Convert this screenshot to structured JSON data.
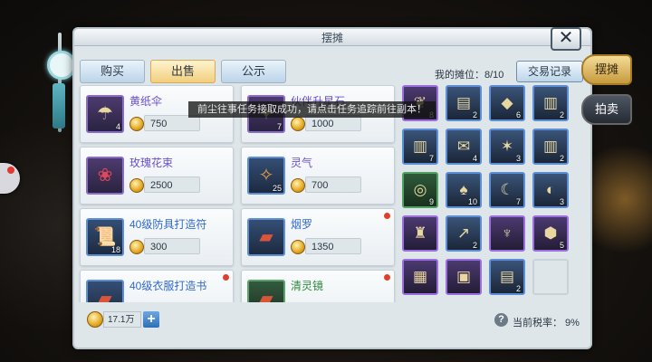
{
  "window": {
    "title": "摆摊",
    "close_glyph": "✕"
  },
  "tabs": {
    "buy": "购买",
    "sell": "出售",
    "public": "公示"
  },
  "stall_info": "我的摊位：8/10",
  "trade_log": "交易记录",
  "side_tabs": {
    "stall": "摆摊",
    "auction": "拍卖"
  },
  "listings": [
    {
      "name": "黄纸伞",
      "count": "4",
      "price": "750",
      "icon": "umbrella-icon",
      "rarity": "purple"
    },
    {
      "name": "伙伴升星石",
      "count": "7",
      "price": "1000",
      "icon": "star-stone-icon",
      "rarity": "purple"
    },
    {
      "name": "玫瑰花束",
      "count": "",
      "price": "2500",
      "icon": "rose-bouquet-icon",
      "rarity": "purple"
    },
    {
      "name": "灵气",
      "count": "25",
      "price": "700",
      "icon": "aura-icon",
      "rarity": "blue"
    },
    {
      "name": "40级防具打造符",
      "count": "18",
      "price": "300",
      "icon": "scroll-icon",
      "rarity": "blue"
    },
    {
      "name": "烟罗",
      "count": "",
      "price": "1350",
      "icon": "firework-icon",
      "rarity": "blue"
    },
    {
      "name": "40级衣服打造书",
      "count": "",
      "price": "",
      "icon": "book-icon",
      "rarity": "blue"
    },
    {
      "name": "清灵镜",
      "count": "",
      "price": "",
      "icon": "mirror-icon",
      "rarity": "green"
    }
  ],
  "inventory": [
    {
      "icon": "herb-icon",
      "count": "8",
      "rarity": "purple"
    },
    {
      "icon": "cloth-icon",
      "count": "2",
      "rarity": "blue"
    },
    {
      "icon": "ore-icon",
      "count": "6",
      "rarity": "blue"
    },
    {
      "icon": "paper-icon",
      "count": "2",
      "rarity": "blue"
    },
    {
      "icon": "paper-icon",
      "count": "7",
      "rarity": "blue"
    },
    {
      "icon": "scroll-icon",
      "count": "4",
      "rarity": "blue"
    },
    {
      "icon": "crystal-icon",
      "count": "3",
      "rarity": "blue"
    },
    {
      "icon": "paper-icon",
      "count": "2",
      "rarity": "blue"
    },
    {
      "icon": "mirror-icon",
      "count": "9",
      "rarity": "green"
    },
    {
      "icon": "pouch-icon",
      "count": "10",
      "rarity": "blue"
    },
    {
      "icon": "claw-icon",
      "count": "7",
      "rarity": "blue"
    },
    {
      "icon": "disk-icon",
      "count": "3",
      "rarity": "blue"
    },
    {
      "icon": "armor-icon",
      "count": "",
      "rarity": "purple"
    },
    {
      "icon": "spear-icon",
      "count": "2",
      "rarity": "blue"
    },
    {
      "icon": "trident-icon",
      "count": "",
      "rarity": "purple"
    },
    {
      "icon": "shield-icon",
      "count": "5",
      "rarity": "purple"
    },
    {
      "icon": "map-icon",
      "count": "",
      "rarity": "purple"
    },
    {
      "icon": "tome-icon",
      "count": "",
      "rarity": "purple"
    },
    {
      "icon": "cloth-icon",
      "count": "2",
      "rarity": "blue"
    },
    {
      "icon": "empty-slot",
      "count": "",
      "rarity": "empty"
    }
  ],
  "currency": {
    "amount": "17.1万",
    "add_label": "+"
  },
  "tax": {
    "help_glyph": "?",
    "label": "当前税率：  9%"
  },
  "toast": "前尘往事任务接取成功，请点击任务追踪前往副本！"
}
